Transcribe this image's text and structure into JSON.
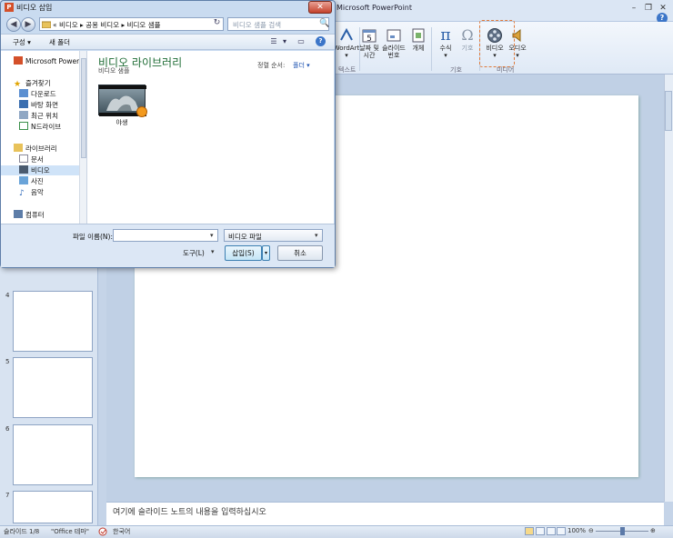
{
  "app": {
    "title": "Microsoft PowerPoint",
    "help_glyph": "?",
    "window_controls": {
      "minimize": "–",
      "restore": "❐",
      "close": "✕"
    }
  },
  "ribbon": {
    "items": [
      {
        "label": "WordArt",
        "sub": "▾",
        "icon": "wordart-icon"
      },
      {
        "label": "날짜 및",
        "sub": "시간",
        "icon": "calendar-icon"
      },
      {
        "label": "슬라이드",
        "sub": "번호",
        "icon": "slide-number-icon"
      },
      {
        "label": "개체",
        "sub": "",
        "icon": "object-icon"
      },
      {
        "label": "수식",
        "sub": "▾",
        "icon": "pi-icon"
      },
      {
        "label": "기호",
        "sub": "",
        "icon": "omega-icon"
      },
      {
        "label": "비디오",
        "sub": "▾",
        "icon": "film-reel-icon"
      },
      {
        "label": "오디오",
        "sub": "▾",
        "icon": "speaker-icon"
      }
    ],
    "groups": {
      "text": "텍스트",
      "symbols": "기호",
      "media": "미디어"
    },
    "glyphs": {
      "pi": "π",
      "omega": "Ω",
      "calendar_num": "5"
    }
  },
  "slide_panel": {
    "thumbnails": [
      "4",
      "5",
      "6",
      "7"
    ]
  },
  "notes": {
    "placeholder": "여기에 슬라이드 노트의 내용을 입력하십시오"
  },
  "status_bar": {
    "slide_info": "슬라이드 1/8",
    "theme": "\"Office 테마\"",
    "language": "한국어",
    "zoom": "100%",
    "zoom_minus": "⊖",
    "zoom_plus": "⊕"
  },
  "dialog": {
    "title": "비디오 삽입",
    "app_icon": "P",
    "close_glyph": "✕",
    "nav_back_glyph": "◀",
    "nav_fwd_glyph": "▶",
    "refresh_glyph": "↻",
    "search_glyph": "🔍",
    "address": "« 비디오 ▸ 공용 비디오 ▸ 비디오 샘플",
    "search_placeholder": "비디오 샘플 검색",
    "toolbar": {
      "organize": "구성 ▾",
      "new_folder": "새 폴더"
    },
    "toolbar_glyphs": {
      "view": "☰",
      "view_dd": "▾",
      "preview": "▭",
      "help": "?"
    },
    "nav": {
      "items": [
        {
          "label": "Microsoft PowerPoint",
          "icon": "powerpoint-icon",
          "indent": 0
        },
        {
          "label": "즐겨찾기",
          "icon": "star-icon",
          "indent": 0
        },
        {
          "label": "다운로드",
          "icon": "downloads-icon",
          "indent": 1
        },
        {
          "label": "바탕 화면",
          "icon": "desktop-icon",
          "indent": 1
        },
        {
          "label": "최근 위치",
          "icon": "recent-icon",
          "indent": 1
        },
        {
          "label": "N드라이브",
          "icon": "ndrive-icon",
          "indent": 1
        },
        {
          "label": "라이브러리",
          "icon": "library-icon",
          "indent": 0
        },
        {
          "label": "문서",
          "icon": "documents-icon",
          "indent": 1
        },
        {
          "label": "비디오",
          "icon": "videos-icon",
          "indent": 1
        },
        {
          "label": "사진",
          "icon": "pictures-icon",
          "indent": 1
        },
        {
          "label": "음악",
          "icon": "music-icon",
          "indent": 1
        },
        {
          "label": "컴퓨터",
          "icon": "computer-icon",
          "indent": 0
        }
      ],
      "selected_index": 8
    },
    "library": {
      "title": "비디오 라이브러리",
      "subtitle": "비디오 샘플",
      "sort_label": "정렬 순서:",
      "sort_value": "폴더 ▾"
    },
    "files": [
      {
        "name": "야생"
      }
    ],
    "filename_label": "파일 이름(N):",
    "filename_value": "",
    "filetype_value": "비디오 파일",
    "dropdown_glyph": "▾",
    "tools_label": "도구(L)",
    "insert_label": "삽입(S)",
    "insert_dd_glyph": "▾",
    "cancel_label": "취소"
  },
  "colors": {
    "accent": "#3c7fb1",
    "library_title": "#1c6b33",
    "highlight": "#e07a3a",
    "close": "#c4412b"
  }
}
